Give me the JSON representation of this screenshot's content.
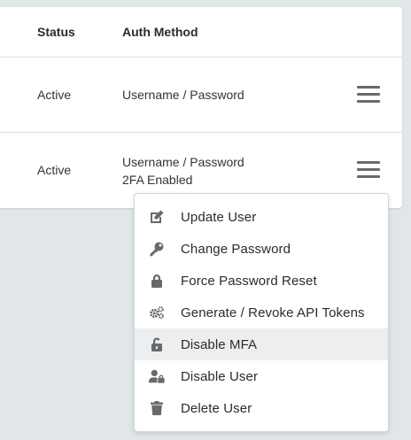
{
  "table": {
    "headers": {
      "status": "Status",
      "auth_method": "Auth Method"
    },
    "rows": [
      {
        "status": "Active",
        "auth_line1": "Username / Password",
        "auth_line2": ""
      },
      {
        "status": "Active",
        "auth_line1": "Username / Password",
        "auth_line2": "2FA Enabled"
      }
    ]
  },
  "menu": {
    "items": [
      {
        "label": "Update User",
        "icon": "edit-icon"
      },
      {
        "label": "Change Password",
        "icon": "key-icon"
      },
      {
        "label": "Force Password Reset",
        "icon": "lock-icon"
      },
      {
        "label": "Generate / Revoke API Tokens",
        "icon": "gears-icon"
      },
      {
        "label": "Disable MFA",
        "icon": "unlock-icon",
        "highlighted": true
      },
      {
        "label": "Disable User",
        "icon": "user-lock-icon"
      },
      {
        "label": "Delete User",
        "icon": "trash-icon"
      }
    ]
  },
  "colors": {
    "background": "#e1e6e8",
    "icon": "#666a6c",
    "highlight": "#eceeef"
  }
}
